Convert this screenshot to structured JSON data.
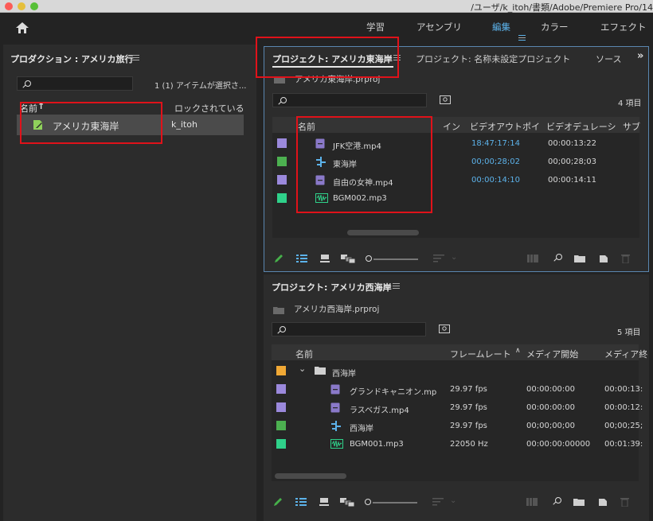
{
  "window": {
    "title": "/ユーザ/k_itoh/書類/Adobe/Premiere Pro/14"
  },
  "workspaces": [
    {
      "label": "学習"
    },
    {
      "label": "アセンブリ"
    },
    {
      "label": "編集",
      "active": true
    },
    {
      "label": "カラー"
    },
    {
      "label": "エフェクト"
    }
  ],
  "production": {
    "title": "プロダクション : アメリカ旅行",
    "selection_status": "1 (1) アイテムが選択さ...",
    "col_name": "名前",
    "col_locked": "ロックされている",
    "items": [
      {
        "name": "アメリカ東海岸",
        "locked_by": "k_itoh"
      }
    ]
  },
  "project_east": {
    "tab_active": "プロジェクト: アメリカ東海岸",
    "tab_other": "プロジェクト: 名称未設定プロジェクト",
    "tab_source": "ソース",
    "overflow": "»",
    "file": "アメリカ東海岸.prproj",
    "count": "4 項目",
    "columns": [
      "名前",
      "イン",
      "ビデオアウトポイ",
      "ビデオデュレーシ",
      "サブ"
    ],
    "rows": [
      {
        "name": "JFK空港.mp4",
        "type": "video",
        "out": "18:47:17:14",
        "dur": "00:00:13:22",
        "color": "#9b89dc"
      },
      {
        "name": "東海岸",
        "type": "sequence",
        "out": "00;00;28;02",
        "dur": "00;00;28;03",
        "color": "#4cb050"
      },
      {
        "name": "自由の女神.mp4",
        "type": "video",
        "out": "00:00:14:10",
        "dur": "00:00:14:11",
        "color": "#9b89dc"
      },
      {
        "name": "BGM002.mp3",
        "type": "audio",
        "out": "",
        "dur": "",
        "color": "#2fd18a"
      }
    ]
  },
  "project_west": {
    "title": "プロジェクト: アメリカ西海岸",
    "file": "アメリカ西海岸.prproj",
    "count": "5 項目",
    "columns": [
      "名前",
      "フレームレート",
      "メディア開始",
      "メディア終"
    ],
    "rows": [
      {
        "name": "西海岸",
        "type": "folder",
        "fps": "",
        "start": "",
        "end": "",
        "color": "#f0a835",
        "indent": 0
      },
      {
        "name": "グランドキャニオン.mp",
        "type": "video",
        "fps": "29.97 fps",
        "start": "00:00:00:00",
        "end": "00:00:13:",
        "color": "#9b89dc",
        "indent": 1
      },
      {
        "name": "ラスベガス.mp4",
        "type": "video",
        "fps": "29.97 fps",
        "start": "00:00:00:00",
        "end": "00:00:12:",
        "color": "#9b89dc",
        "indent": 1
      },
      {
        "name": "西海岸",
        "type": "sequence",
        "fps": "29.97 fps",
        "start": "00;00;00;00",
        "end": "00;00;25;",
        "color": "#4cb050",
        "indent": 1
      },
      {
        "name": "BGM001.mp3",
        "type": "audio",
        "fps": "22050 Hz",
        "start": "00:00:00:00000",
        "end": "00:01:39:",
        "color": "#2fd18a",
        "indent": 1
      }
    ]
  },
  "colors": {
    "accent_blue": "#5cb2ea",
    "highlight_red": "#e0121a",
    "panel_bg": "#2c2c2c",
    "app_bg": "#232323"
  }
}
